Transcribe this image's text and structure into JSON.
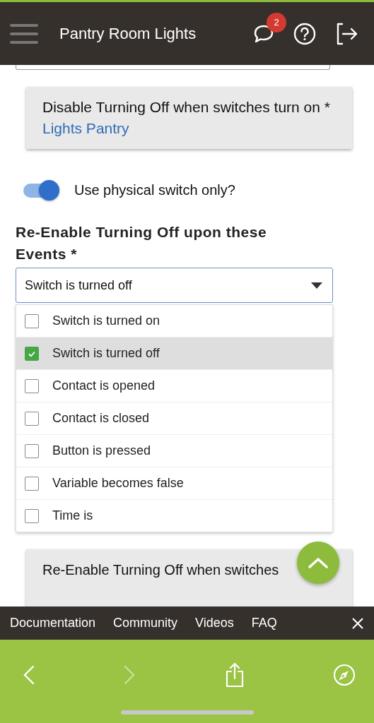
{
  "header": {
    "title": "Pantry Room Lights",
    "notification_count": "2"
  },
  "device_card": {
    "title": "Disable Turning Off when switches turn on *",
    "value": "Lights Pantry"
  },
  "physical_switch": {
    "label": "Use physical switch only?",
    "on": true
  },
  "events": {
    "label": "Re-Enable Turning Off upon these Events *",
    "value": "Switch is turned off",
    "expanded": true,
    "options": [
      {
        "label": "Switch is turned on",
        "checked": false
      },
      {
        "label": "Switch is turned off",
        "checked": true
      },
      {
        "label": "Contact is opened",
        "checked": false
      },
      {
        "label": "Contact is closed",
        "checked": false
      },
      {
        "label": "Button is pressed",
        "checked": false
      },
      {
        "label": "Variable becomes false",
        "checked": false
      },
      {
        "label": "Time is",
        "checked": false
      }
    ]
  },
  "next_card": {
    "title": "Re-Enable Turning Off when switches"
  },
  "footer_links": [
    "Documentation",
    "Community",
    "Videos",
    "FAQ"
  ],
  "browser_toolbar": {
    "forward_disabled": true
  }
}
